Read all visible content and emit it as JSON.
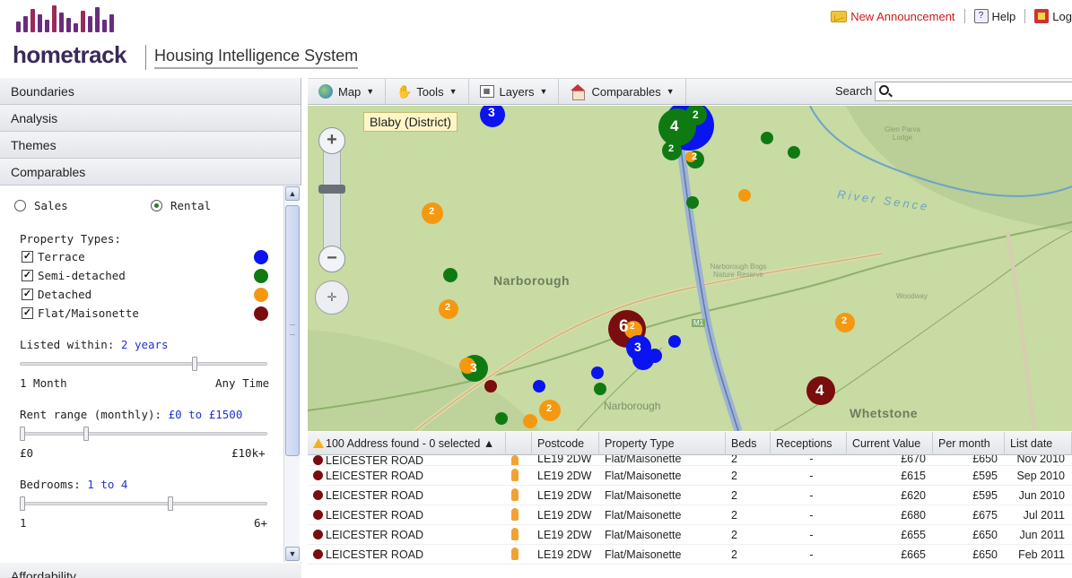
{
  "header": {
    "brand": "hometrack",
    "subtitle": "Housing Intelligence System",
    "links": {
      "announcement": "New Announcement",
      "help": "Help",
      "logout": "Log"
    }
  },
  "sidebar": {
    "sections": [
      "Boundaries",
      "Analysis",
      "Themes",
      "Comparables"
    ],
    "comparables": {
      "mode_sales": "Sales",
      "mode_rental": "Rental",
      "selected_mode": "Rental",
      "property_types_label": "Property Types:",
      "property_types": [
        {
          "label": "Terrace",
          "checked": true,
          "color": "#0a14f0"
        },
        {
          "label": "Semi-detached",
          "checked": true,
          "color": "#0f7a12"
        },
        {
          "label": "Detached",
          "checked": true,
          "color": "#f5980f"
        },
        {
          "label": "Flat/Maisonette",
          "checked": true,
          "color": "#7a0d0d"
        }
      ],
      "listed_within_label": "Listed within:",
      "listed_within_value": "2 years",
      "listed_min": "1 Month",
      "listed_max": "Any Time",
      "rent_label": "Rent range (monthly):",
      "rent_value": "£0 to £1500",
      "rent_min": "£0",
      "rent_max": "£10k+",
      "bedrooms_label": "Bedrooms:",
      "bedrooms_value": "1 to 4",
      "bedrooms_min": "1",
      "bedrooms_max": "6+"
    },
    "affordability": "Affordability"
  },
  "toolbar": {
    "map": "Map",
    "tools": "Tools",
    "layers": "Layers",
    "comparables": "Comparables",
    "search_label": "Search",
    "search_value": ""
  },
  "map": {
    "area_label": "Blaby (District)",
    "labels": {
      "narborough_big": "Narborough",
      "narborough_station": "Narborough",
      "whetstone": "Whetstone",
      "glen_parva": "Glen Parva Lodge",
      "bogs": "Narborough Bogs Nature Reserve",
      "woodway": "Woodway",
      "motorway": "M1",
      "river": "River Sence"
    },
    "cluster_labels": [
      "3",
      "4",
      "2",
      "2",
      "2",
      "2",
      "2",
      "6",
      "2",
      "3",
      "3",
      "4",
      "2",
      "2"
    ]
  },
  "grid": {
    "summary": "100 Address found - 0 selected",
    "columns": [
      "Postcode",
      "Property Type",
      "Beds",
      "Receptions",
      "Current Value",
      "Per month",
      "List date"
    ],
    "rows": [
      {
        "address": "LEICESTER ROAD",
        "postcode": "LE19 2DW",
        "type": "Flat/Maisonette",
        "beds": "2",
        "receptions": "-",
        "value": "£670",
        "per_month": "£650",
        "date": "Nov 2010"
      },
      {
        "address": "LEICESTER ROAD",
        "postcode": "LE19 2DW",
        "type": "Flat/Maisonette",
        "beds": "2",
        "receptions": "-",
        "value": "£615",
        "per_month": "£595",
        "date": "Sep 2010"
      },
      {
        "address": "LEICESTER ROAD",
        "postcode": "LE19 2DW",
        "type": "Flat/Maisonette",
        "beds": "2",
        "receptions": "-",
        "value": "£620",
        "per_month": "£595",
        "date": "Jun 2010"
      },
      {
        "address": "LEICESTER ROAD",
        "postcode": "LE19 2DW",
        "type": "Flat/Maisonette",
        "beds": "2",
        "receptions": "-",
        "value": "£680",
        "per_month": "£675",
        "date": "Jul 2011"
      },
      {
        "address": "LEICESTER ROAD",
        "postcode": "LE19 2DW",
        "type": "Flat/Maisonette",
        "beds": "2",
        "receptions": "-",
        "value": "£655",
        "per_month": "£650",
        "date": "Jun 2011"
      },
      {
        "address": "LEICESTER ROAD",
        "postcode": "LE19 2DW",
        "type": "Flat/Maisonette",
        "beds": "2",
        "receptions": "-",
        "value": "£665",
        "per_month": "£650",
        "date": "Feb 2011"
      }
    ]
  }
}
